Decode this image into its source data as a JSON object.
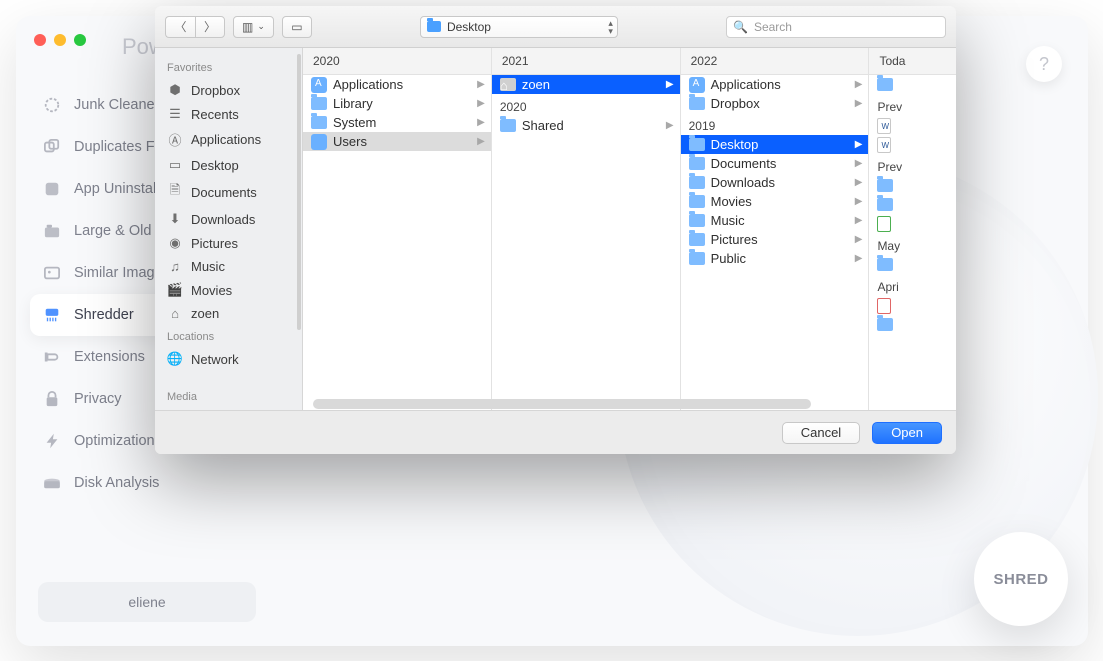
{
  "app": {
    "title": "Powe",
    "help_label": "?",
    "user_badge": "eliene",
    "shred_label": "SHRED"
  },
  "sidebar": {
    "items": [
      {
        "label": "Junk Cleaner"
      },
      {
        "label": "Duplicates Fin"
      },
      {
        "label": "App Uninstalle"
      },
      {
        "label": "Large & Old Fil"
      },
      {
        "label": "Similar Image"
      },
      {
        "label": "Shredder"
      },
      {
        "label": "Extensions"
      },
      {
        "label": "Privacy"
      },
      {
        "label": "Optimization"
      },
      {
        "label": "Disk Analysis"
      }
    ]
  },
  "dialog": {
    "path_label": "Desktop",
    "search_placeholder": "Search",
    "cancel_label": "Cancel",
    "open_label": "Open",
    "sidebar": {
      "favorites_header": "Favorites",
      "locations_header": "Locations",
      "media_header": "Media",
      "favorites": [
        {
          "label": "Dropbox"
        },
        {
          "label": "Recents"
        },
        {
          "label": "Applications"
        },
        {
          "label": "Desktop"
        },
        {
          "label": "Documents"
        },
        {
          "label": "Downloads"
        },
        {
          "label": "Pictures"
        },
        {
          "label": "Music"
        },
        {
          "label": "Movies"
        },
        {
          "label": "zoen"
        }
      ],
      "locations": [
        {
          "label": "Network"
        }
      ]
    },
    "columns": [
      {
        "header": "2020",
        "rows": [
          {
            "label": "Applications",
            "type": "app",
            "arrow": true
          },
          {
            "label": "Library",
            "type": "folder",
            "arrow": true
          },
          {
            "label": "System",
            "type": "folder",
            "arrow": true
          },
          {
            "label": "Users",
            "type": "users",
            "arrow": true,
            "selected": "grey"
          }
        ]
      },
      {
        "header": "2021",
        "rows": [
          {
            "label": "zoen",
            "type": "home",
            "arrow": true,
            "selected": "blue"
          },
          {
            "label": "2020",
            "type": "plain"
          },
          {
            "label": "Shared",
            "type": "folder",
            "arrow": true
          }
        ]
      },
      {
        "header": "2022",
        "rows": [
          {
            "label": "Applications",
            "type": "app",
            "arrow": true
          },
          {
            "label": "Dropbox",
            "type": "folder",
            "arrow": true
          },
          {
            "label": "2019",
            "type": "plain"
          },
          {
            "label": "Desktop",
            "type": "folder",
            "arrow": true,
            "selected": "blue"
          },
          {
            "label": "Documents",
            "type": "folder",
            "arrow": true
          },
          {
            "label": "Downloads",
            "type": "folder",
            "arrow": true
          },
          {
            "label": "Movies",
            "type": "folder",
            "arrow": true
          },
          {
            "label": "Music",
            "type": "folder",
            "arrow": true
          },
          {
            "label": "Pictures",
            "type": "folder",
            "arrow": true
          },
          {
            "label": "Public",
            "type": "folder",
            "arrow": true
          }
        ]
      },
      {
        "header": "Toda",
        "rows": [
          {
            "label": "",
            "type": "folder"
          },
          {
            "label": "Prev",
            "type": "plain"
          },
          {
            "label": "",
            "type": "doc-word-a"
          },
          {
            "label": "",
            "type": "doc-word-b"
          },
          {
            "label": "Prev",
            "type": "plain"
          },
          {
            "label": "",
            "type": "folder"
          },
          {
            "label": "",
            "type": "folder"
          },
          {
            "label": "",
            "type": "doc-xls"
          },
          {
            "label": "May",
            "type": "plain"
          },
          {
            "label": "",
            "type": "folder"
          },
          {
            "label": "Apri",
            "type": "plain"
          },
          {
            "label": "",
            "type": "doc-pdf"
          },
          {
            "label": "",
            "type": "folder"
          }
        ]
      }
    ]
  }
}
